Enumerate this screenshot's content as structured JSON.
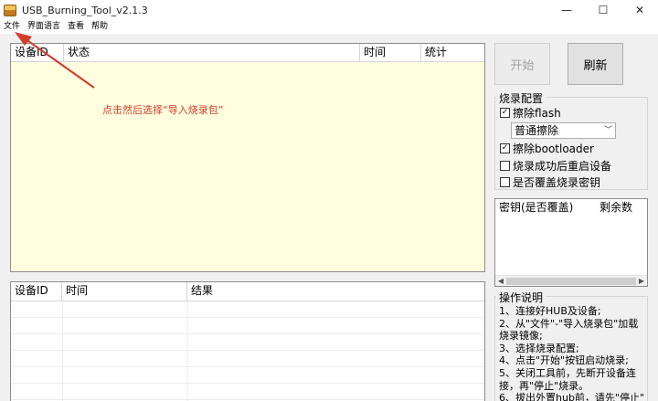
{
  "window": {
    "title": "USB_Burning_Tool_v2.1.3",
    "minimize": "—",
    "maximize": "☐",
    "close": "✕"
  },
  "menu": [
    "文件",
    "界面语言",
    "查看",
    "帮助"
  ],
  "device_table": {
    "columns": [
      "设备ID",
      "状态",
      "时间",
      "统计"
    ],
    "annotation": "点击然后选择“导入烧录包”"
  },
  "log_table": {
    "columns": [
      "设备ID",
      "时间",
      "结果"
    ]
  },
  "buttons": {
    "start": "开始",
    "refresh": "刷新"
  },
  "burn_config": {
    "title": "烧录配置",
    "erase_flash": {
      "label": "擦除flash",
      "checked": true
    },
    "erase_mode": "普通擦除",
    "erase_bootloader": {
      "label": "擦除bootloader",
      "checked": true
    },
    "reboot_after": {
      "label": "烧录成功后重启设备",
      "checked": false
    },
    "overwrite_key": {
      "label": "是否覆盖烧录密钥",
      "checked": false
    }
  },
  "key_list": {
    "columns": [
      "密钥(是否覆盖)",
      "剩余数"
    ]
  },
  "instructions": {
    "title": "操作说明",
    "lines": [
      "1、连接好HUB及设备;",
      "2、从\"文件\"-\"导入烧录包\"加载烧录镜像;",
      "3、选择烧录配置;",
      "4、点击\"开始\"按钮启动烧录;",
      "5、关闭工具前，先断开设备连接，再\"停止\"烧录。",
      "6、拔出外置hub前，请先\"停止\""
    ]
  },
  "colors": {
    "annotation": "#d23c2a",
    "device_area": "#ffffe0"
  }
}
